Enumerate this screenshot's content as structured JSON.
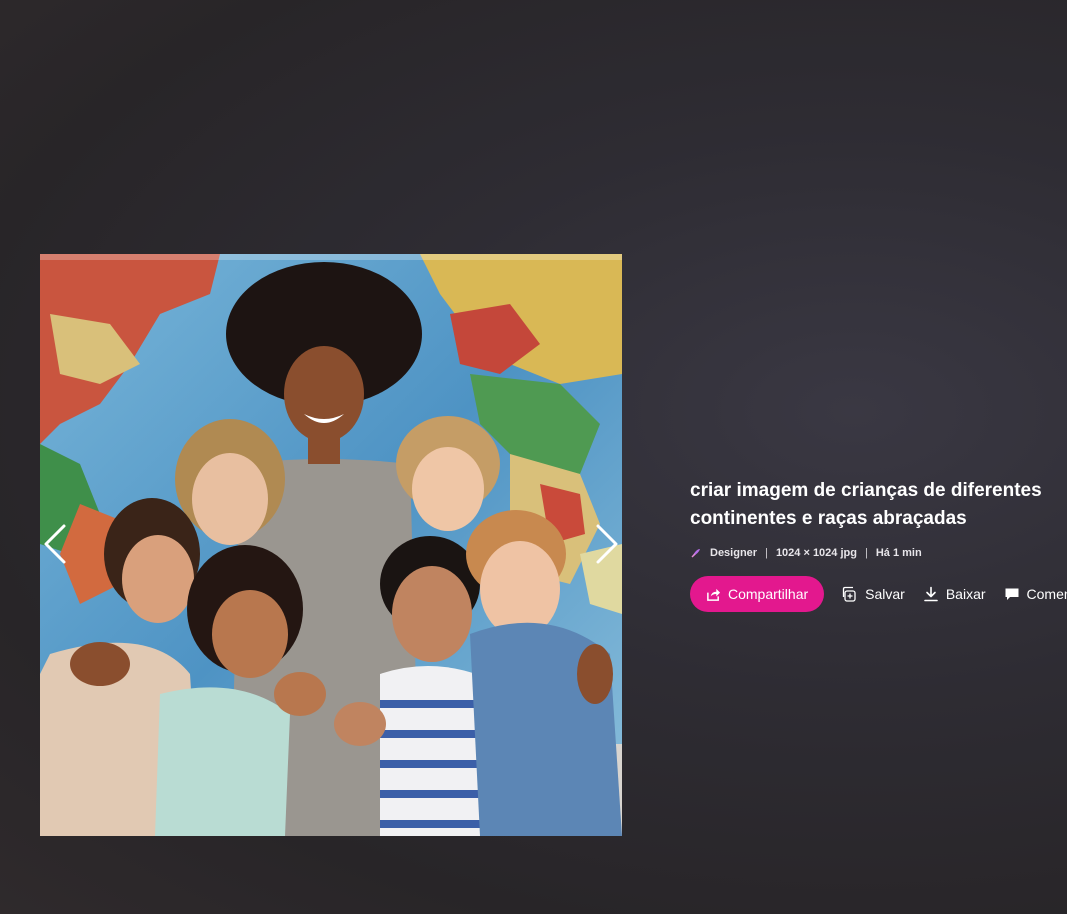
{
  "image": {
    "alt": "Imagem gerada"
  },
  "navigation": {
    "prev_icon": "chevron-left-icon",
    "next_icon": "chevron-right-icon"
  },
  "details": {
    "title": "criar imagem de crianças de diferentes continentes e raças abraçadas",
    "source": "Designer",
    "resolution": "1024 × 1024 jpg",
    "time": "Há 1 min",
    "separator": "|"
  },
  "actions": {
    "share_label": "Compartilhar",
    "save_label": "Salvar",
    "download_label": "Baixar",
    "comment_label": "Comentar"
  },
  "colors": {
    "share_button": "#e3188e",
    "background": "#2e2c33"
  }
}
